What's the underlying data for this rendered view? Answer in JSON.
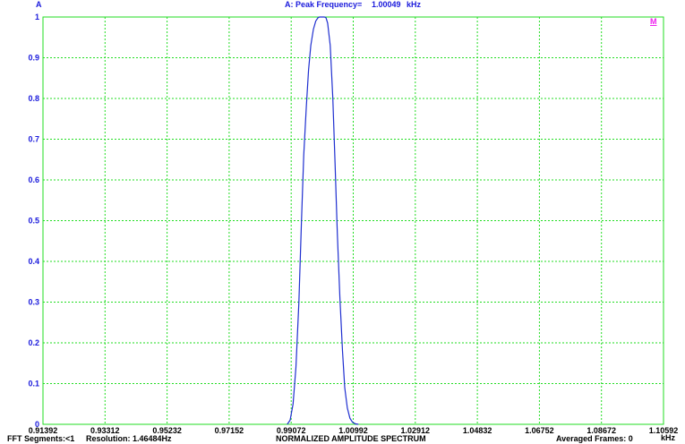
{
  "header": {
    "channel": "A",
    "peak_label": "A: Peak Frequency=",
    "peak_value": "1.00049",
    "peak_unit": "kHz"
  },
  "marker_glyph": "M",
  "footer": {
    "fft_segments": "FFT Segments:<1",
    "resolution": "Resolution: 1.46484Hz",
    "title": "NORMALIZED AMPLITUDE SPECTRUM",
    "averaged_frames": "Averaged Frames: 0"
  },
  "colors": {
    "frame": "#22dd22",
    "grid": "#22dd22",
    "trace": "#1f2fd0",
    "marker": "#ee22ee",
    "axis_text_y": "#1a1adc",
    "axis_text_x": "#000000"
  },
  "chart_data": {
    "type": "line",
    "title": "NORMALIZED AMPLITUDE SPECTRUM",
    "xunit": "kHz",
    "xlim": [
      0.91392,
      1.10592
    ],
    "ylim": [
      0,
      1
    ],
    "grid": true,
    "xticks": [
      "0.91392",
      "0.93312",
      "0.95232",
      "0.97152",
      "0.99072",
      "1.00992",
      "1.02912",
      "1.04832",
      "1.06752",
      "1.08672",
      "1.10592"
    ],
    "yticks": [
      "0",
      "0.1",
      "0.2",
      "0.3",
      "0.4",
      "0.5",
      "0.6",
      "0.7",
      "0.8",
      "0.9",
      "1"
    ],
    "series": [
      {
        "x": [
          0.9895,
          0.9904,
          0.9913,
          0.9922,
          0.9931,
          0.9939,
          0.9946,
          0.9954,
          0.9961,
          0.9968,
          0.9976,
          0.9983,
          0.999,
          0.9995,
          1.0,
          1.00049,
          1.001,
          1.0015,
          1.002,
          1.0028,
          1.0036,
          1.0043,
          1.005,
          1.0058,
          1.0066,
          1.0073,
          1.0081,
          1.0089,
          1.0097,
          1.0106,
          1.0115
        ],
        "y": [
          0.0,
          0.01,
          0.05,
          0.14,
          0.3,
          0.5,
          0.66,
          0.78,
          0.87,
          0.93,
          0.97,
          0.99,
          0.998,
          1.0,
          1.0,
          1.0,
          1.0,
          0.998,
          0.985,
          0.93,
          0.8,
          0.64,
          0.47,
          0.31,
          0.18,
          0.09,
          0.04,
          0.015,
          0.005,
          0.001,
          0.0
        ]
      }
    ]
  }
}
